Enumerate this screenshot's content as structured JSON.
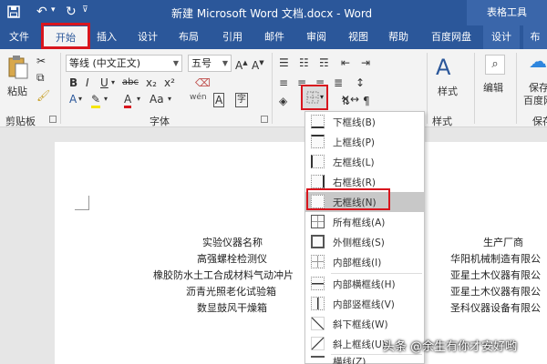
{
  "titlebar": {
    "title": "新建 Microsoft Word 文档.docx - Word",
    "context_group": "表格工具"
  },
  "tabs": [
    {
      "label": "文件"
    },
    {
      "label": "开始"
    },
    {
      "label": "插入"
    },
    {
      "label": "设计"
    },
    {
      "label": "布局"
    },
    {
      "label": "引用"
    },
    {
      "label": "邮件"
    },
    {
      "label": "审阅"
    },
    {
      "label": "视图"
    },
    {
      "label": "帮助"
    },
    {
      "label": "百度网盘"
    },
    {
      "label": "设计"
    },
    {
      "label": "布"
    }
  ],
  "ribbon": {
    "clipboard": {
      "paste_label": "粘贴",
      "group_label": "剪贴板"
    },
    "font": {
      "font_name": "等线 (中文正文)",
      "font_size": "五号",
      "group_label": "字体",
      "text_wen": "wén",
      "text_a": "A",
      "text_b": "B",
      "text_i": "I",
      "text_u": "U",
      "text_abc": "abc",
      "text_x2": "x₂",
      "text_x2sup": "x²",
      "text_aa": "Aa"
    },
    "styles": {
      "label": "样式",
      "group_label": "样式"
    },
    "editing": {
      "label": "编辑"
    },
    "baidu": {
      "label_line1": "保存",
      "label_line2": "百度网",
      "group_label": "保存"
    }
  },
  "document": {
    "headers": {
      "name": "实验仪器名称",
      "maker": "生产厂商"
    },
    "rows": [
      {
        "name": "高强螺栓检测仪",
        "maker": "华阳机械制造有限公"
      },
      {
        "name": "橡胶防水土工合成材料气动冲片",
        "maker": "亚星土木仪器有限公"
      },
      {
        "name": "沥青光照老化试验箱",
        "maker": "亚星土木仪器有限公"
      },
      {
        "name": "数显鼓风干燥箱",
        "maker": "圣科仪器设备有限公"
      }
    ]
  },
  "border_menu": {
    "items": [
      {
        "label": "下框线(B)"
      },
      {
        "label": "上框线(P)"
      },
      {
        "label": "左框线(L)"
      },
      {
        "label": "右框线(R)"
      },
      {
        "label": "无框线(N)"
      },
      {
        "label": "所有框线(A)"
      },
      {
        "label": "外侧框线(S)"
      },
      {
        "label": "内部框线(I)"
      },
      {
        "label": "内部横框线(H)"
      },
      {
        "label": "内部竖框线(V)"
      },
      {
        "label": "斜下框线(W)"
      },
      {
        "label": "斜上框线(U)"
      },
      {
        "label": "横线(Z)"
      }
    ],
    "selected": "无框线(N)"
  },
  "watermark": "头条 @余生有你才安好哟",
  "colors": {
    "accent": "#2b579a",
    "highlight_red": "#d8161e"
  }
}
